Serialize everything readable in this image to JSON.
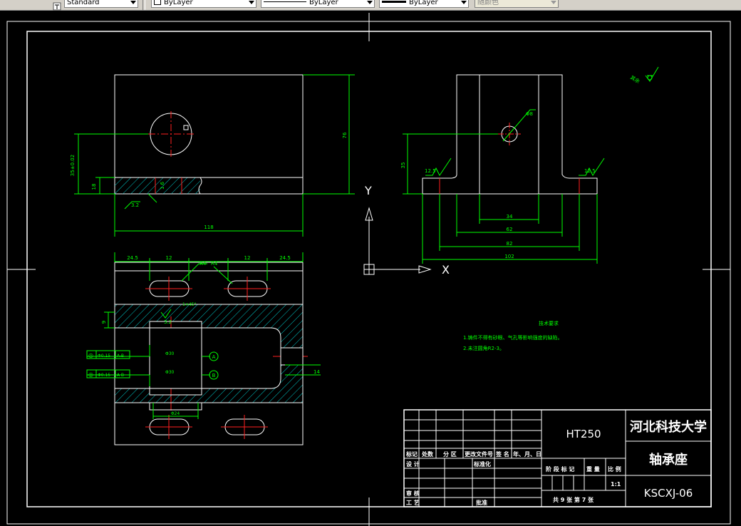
{
  "toolbar": {
    "text_style": "Standard",
    "layer_color": "ByLayer",
    "linetype": "ByLayer",
    "lineweight": "ByLayer",
    "plot_style": "随颜色"
  },
  "ucs": {
    "y_label": "Y",
    "x_label": "X"
  },
  "dims": {
    "front_width": "118",
    "front_height": "76",
    "hole_height": "35±0.02",
    "base_height": "18",
    "rough_front": "3.2",
    "rough_hole": "1.6",
    "top_left": "24.5",
    "top_slot1": "12",
    "top_slot2": "12",
    "top_right": "24.5",
    "hole_label1": "R4",
    "hole_label2": "R4",
    "top_sec_height": "9",
    "rough_top_sec": "3.2",
    "chamfer1": "1×45°",
    "tol1_symbol": "◎",
    "tol1_value": "Φ0.15",
    "tol1_datum": "A-B",
    "tol2_symbol": "◎",
    "tol2_value": "Φ0.15",
    "tol2_datum": "A-B",
    "diam1": "Φ30",
    "diam2": "Φ30",
    "datum_a": "A",
    "datum_b": "B",
    "slot_dim": "14",
    "bottom_diam": "Φ24",
    "side_hole": "Φ8",
    "side_height": "35",
    "rough_left": "12.5",
    "rough_right": "12.5",
    "side_34": "34",
    "side_62": "62",
    "side_82": "82",
    "side_102": "102",
    "rough_other_label": "其余",
    "tech_title": "技术要求",
    "tech_line1": "1.铸件不得有砂眼、气孔等影响强度的缺陷。",
    "tech_line2": "2.未注圆角R2-3。"
  },
  "title_block": {
    "material": "HT250",
    "school": "河北科技大学",
    "part_name": "轴承座",
    "code": "KSCXJ-06",
    "col_mark": "标记",
    "col_count": "处数",
    "col_zone": "分 区",
    "col_change": "更改文件号",
    "col_sign": "签 名",
    "col_date": "年、月、日",
    "row_design": "设 计",
    "row_std": "标准化",
    "row_review": "审 核",
    "row_process": "工 艺",
    "row_approve": "批准",
    "stage": "阶 段 标 记",
    "weight": "重 量",
    "scale": "比 例",
    "scale_value": "1:1",
    "sheets": "共 9  张  第  7 张"
  }
}
